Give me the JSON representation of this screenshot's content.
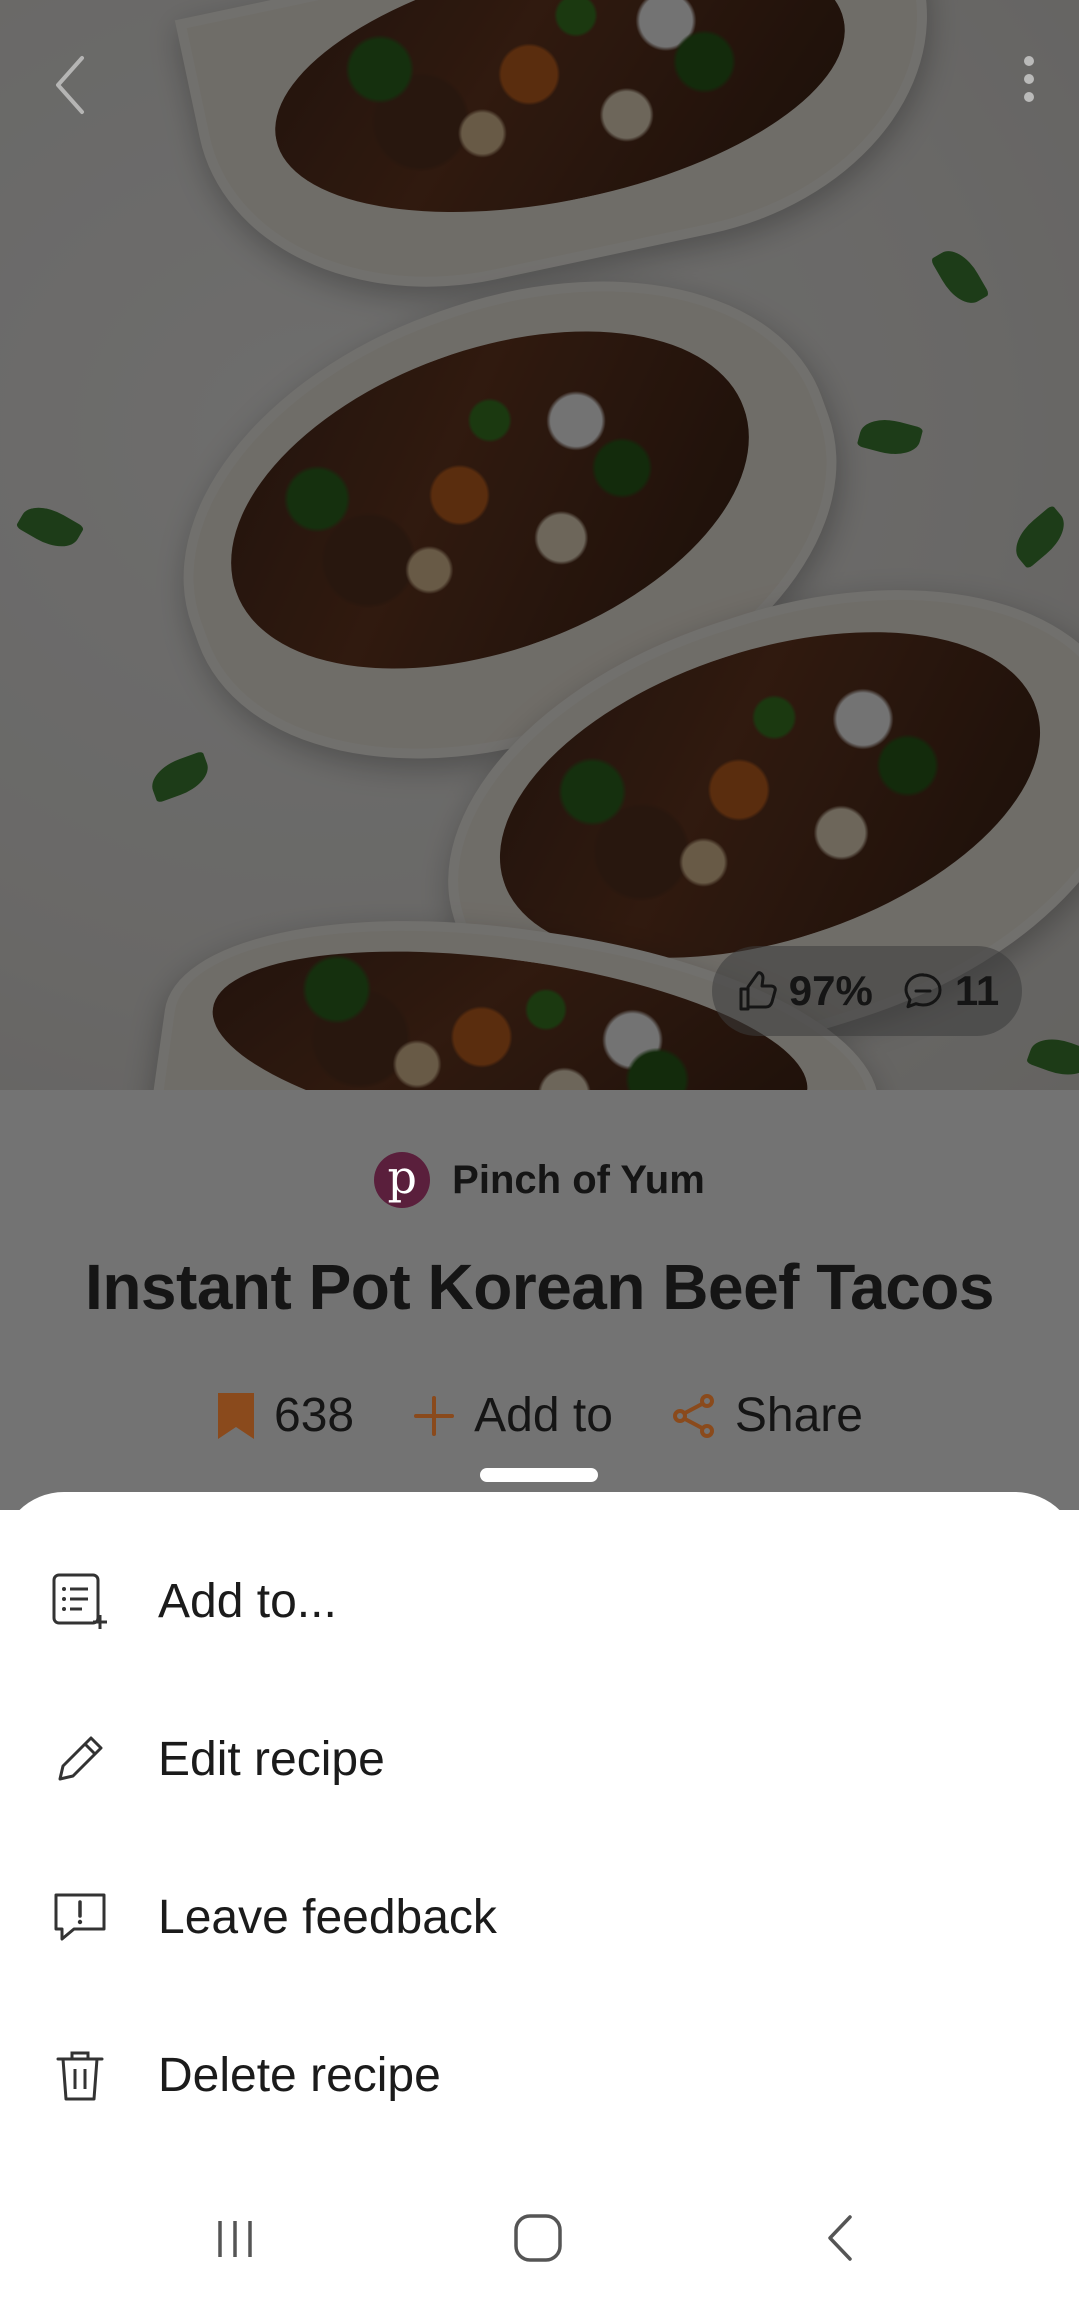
{
  "colors": {
    "accent": "#d9742a",
    "source_logo_bg": "#5a1f3c",
    "overlay": "rgba(0,0,0,0.55)",
    "text": "#151515"
  },
  "hero": {
    "back_icon": "chevron-left-icon",
    "more_icon": "more-vertical-icon",
    "rating": {
      "like_icon": "thumbs-up-icon",
      "like_percent": "97%",
      "comment_icon": "comment-icon",
      "comment_count": "11"
    }
  },
  "recipe": {
    "source": {
      "logo_letter": "p",
      "name": "Pinch of Yum"
    },
    "title": "Instant Pot Korean Beef Tacos",
    "actions": {
      "bookmark_icon": "bookmark-icon",
      "bookmark_count": "638",
      "add_icon": "plus-icon",
      "add_label": "Add to",
      "share_icon": "share-icon",
      "share_label": "Share"
    }
  },
  "sheet": {
    "items": [
      {
        "icon": "list-add-icon",
        "label": "Add to..."
      },
      {
        "icon": "pencil-icon",
        "label": "Edit recipe"
      },
      {
        "icon": "feedback-icon",
        "label": "Leave feedback"
      },
      {
        "icon": "trash-icon",
        "label": "Delete recipe"
      }
    ]
  },
  "navbar": {
    "recents_icon": "recents-icon",
    "home_icon": "home-icon",
    "back_icon": "back-icon"
  }
}
